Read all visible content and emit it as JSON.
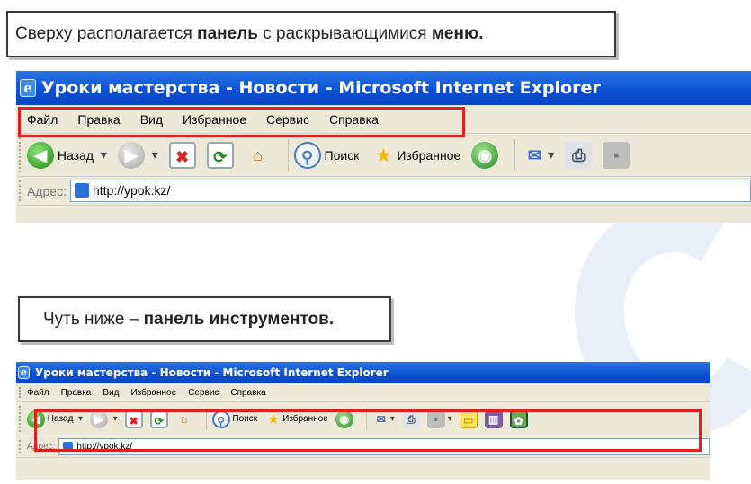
{
  "callouts": {
    "top": {
      "prefix": "Сверху располагается ",
      "bold1": "панель",
      "middle": " с раскрывающимися ",
      "bold2": "меню."
    },
    "middle": {
      "prefix": "Чуть ниже – ",
      "bold": "панель инструментов."
    }
  },
  "browser": {
    "title": "Уроки мастерства - Новости - Microsoft Internet Explorer",
    "menu": [
      "Файл",
      "Правка",
      "Вид",
      "Избранное",
      "Сервис",
      "Справка"
    ],
    "toolbar": {
      "back": "Назад",
      "search": "Поиск",
      "favorites": "Избранное"
    },
    "address": {
      "label": "Адрес:",
      "url": "http://ypok.kz/"
    }
  },
  "colors": {
    "titlebar": "#0a4fd0",
    "chrome": "#ece9d8",
    "highlight": "#e02020"
  }
}
